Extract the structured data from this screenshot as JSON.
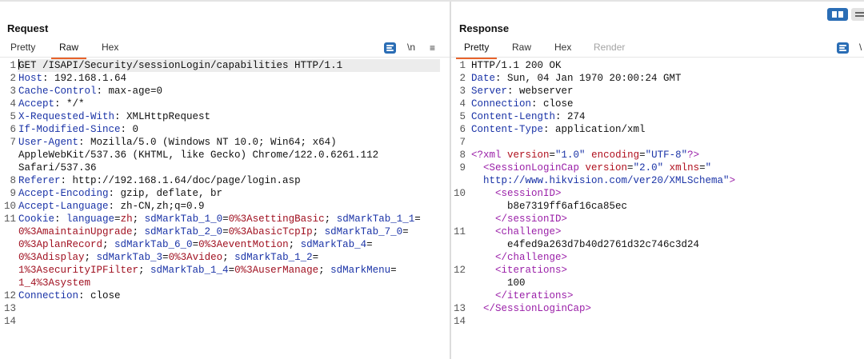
{
  "request": {
    "title": "Request",
    "tabs": [
      "Pretty",
      "Raw",
      "Hex"
    ],
    "active_tab": "Raw",
    "newline_label": "\\n",
    "menu_icon": "hamburger-menu-icon",
    "lines": [
      {
        "n": "1",
        "parts": [
          {
            "t": "GET /ISAPI/Security/sessionLogin/capabilities HTTP/1.1",
            "c": "plain"
          }
        ]
      },
      {
        "n": "2",
        "parts": [
          {
            "t": "Host",
            "c": "key"
          },
          {
            "t": ": 192.168.1.64",
            "c": "plain"
          }
        ]
      },
      {
        "n": "3",
        "parts": [
          {
            "t": "Cache-Control",
            "c": "key"
          },
          {
            "t": ": max-age=0",
            "c": "plain"
          }
        ]
      },
      {
        "n": "4",
        "parts": [
          {
            "t": "Accept",
            "c": "key"
          },
          {
            "t": ": */*",
            "c": "plain"
          }
        ]
      },
      {
        "n": "5",
        "parts": [
          {
            "t": "X-Requested-With",
            "c": "key"
          },
          {
            "t": ": XMLHttpRequest",
            "c": "plain"
          }
        ]
      },
      {
        "n": "6",
        "parts": [
          {
            "t": "If-Modified-Since",
            "c": "key"
          },
          {
            "t": ": 0",
            "c": "plain"
          }
        ]
      },
      {
        "n": "7",
        "parts": [
          {
            "t": "User-Agent",
            "c": "key"
          },
          {
            "t": ": Mozilla/5.0 (Windows NT 10.0; Win64; x64)",
            "c": "plain"
          }
        ]
      },
      {
        "n": "",
        "parts": [
          {
            "t": "AppleWebKit/537.36 (KHTML, like Gecko) Chrome/122.0.6261.112",
            "c": "plain"
          }
        ]
      },
      {
        "n": "",
        "parts": [
          {
            "t": "Safari/537.36",
            "c": "plain"
          }
        ]
      },
      {
        "n": "8",
        "parts": [
          {
            "t": "Referer",
            "c": "key"
          },
          {
            "t": ": http://192.168.1.64/doc/page/login.asp",
            "c": "plain"
          }
        ]
      },
      {
        "n": "9",
        "parts": [
          {
            "t": "Accept-Encoding",
            "c": "key"
          },
          {
            "t": ": gzip, deflate, br",
            "c": "plain"
          }
        ]
      },
      {
        "n": "10",
        "parts": [
          {
            "t": "Accept-Language",
            "c": "key"
          },
          {
            "t": ": zh-CN,zh;q=0.9",
            "c": "plain"
          }
        ]
      },
      {
        "n": "11",
        "parts": [
          {
            "t": "Cookie",
            "c": "key"
          },
          {
            "t": ": ",
            "c": "plain"
          },
          {
            "t": "language",
            "c": "key"
          },
          {
            "t": "=",
            "c": "plain"
          },
          {
            "t": "zh",
            "c": "val"
          },
          {
            "t": "; ",
            "c": "plain"
          },
          {
            "t": "sdMarkTab_1_0",
            "c": "key"
          },
          {
            "t": "=",
            "c": "plain"
          },
          {
            "t": "0%3AsettingBasic",
            "c": "val"
          },
          {
            "t": "; ",
            "c": "plain"
          },
          {
            "t": "sdMarkTab_1_1",
            "c": "key"
          },
          {
            "t": "=",
            "c": "plain"
          }
        ]
      },
      {
        "n": "",
        "parts": [
          {
            "t": "0%3AmaintainUpgrade",
            "c": "val"
          },
          {
            "t": "; ",
            "c": "plain"
          },
          {
            "t": "sdMarkTab_2_0",
            "c": "key"
          },
          {
            "t": "=",
            "c": "plain"
          },
          {
            "t": "0%3AbasicTcpIp",
            "c": "val"
          },
          {
            "t": "; ",
            "c": "plain"
          },
          {
            "t": "sdMarkTab_7_0",
            "c": "key"
          },
          {
            "t": "=",
            "c": "plain"
          }
        ]
      },
      {
        "n": "",
        "parts": [
          {
            "t": "0%3AplanRecord",
            "c": "val"
          },
          {
            "t": "; ",
            "c": "plain"
          },
          {
            "t": "sdMarkTab_6_0",
            "c": "key"
          },
          {
            "t": "=",
            "c": "plain"
          },
          {
            "t": "0%3AeventMotion",
            "c": "val"
          },
          {
            "t": "; ",
            "c": "plain"
          },
          {
            "t": "sdMarkTab_4",
            "c": "key"
          },
          {
            "t": "=",
            "c": "plain"
          }
        ]
      },
      {
        "n": "",
        "parts": [
          {
            "t": "0%3Adisplay",
            "c": "val"
          },
          {
            "t": "; ",
            "c": "plain"
          },
          {
            "t": "sdMarkTab_3",
            "c": "key"
          },
          {
            "t": "=",
            "c": "plain"
          },
          {
            "t": "0%3Avideo",
            "c": "val"
          },
          {
            "t": "; ",
            "c": "plain"
          },
          {
            "t": "sdMarkTab_1_2",
            "c": "key"
          },
          {
            "t": "=",
            "c": "plain"
          }
        ]
      },
      {
        "n": "",
        "parts": [
          {
            "t": "1%3AsecurityIPFilter",
            "c": "val"
          },
          {
            "t": "; ",
            "c": "plain"
          },
          {
            "t": "sdMarkTab_1_4",
            "c": "key"
          },
          {
            "t": "=",
            "c": "plain"
          },
          {
            "t": "0%3AuserManage",
            "c": "val"
          },
          {
            "t": "; ",
            "c": "plain"
          },
          {
            "t": "sdMarkMenu",
            "c": "key"
          },
          {
            "t": "=",
            "c": "plain"
          }
        ]
      },
      {
        "n": "",
        "parts": [
          {
            "t": "1_4%3Asystem",
            "c": "val"
          }
        ]
      },
      {
        "n": "12",
        "parts": [
          {
            "t": "Connection",
            "c": "key"
          },
          {
            "t": ": close",
            "c": "plain"
          }
        ]
      },
      {
        "n": "13",
        "parts": []
      },
      {
        "n": "14",
        "parts": []
      }
    ]
  },
  "response": {
    "title": "Response",
    "tabs": [
      "Pretty",
      "Raw",
      "Hex",
      "Render"
    ],
    "active_tab": "Pretty",
    "newline_label": "\\",
    "lines": [
      {
        "n": "1",
        "parts": [
          {
            "t": "HTTP/1.1 200 OK",
            "c": "plain"
          }
        ]
      },
      {
        "n": "2",
        "parts": [
          {
            "t": "Date",
            "c": "key"
          },
          {
            "t": ": Sun, 04 Jan 1970 20:00:24 GMT",
            "c": "plain"
          }
        ]
      },
      {
        "n": "3",
        "parts": [
          {
            "t": "Server",
            "c": "key"
          },
          {
            "t": ": webserver",
            "c": "plain"
          }
        ]
      },
      {
        "n": "4",
        "parts": [
          {
            "t": "Connection",
            "c": "key"
          },
          {
            "t": ": close",
            "c": "plain"
          }
        ]
      },
      {
        "n": "5",
        "parts": [
          {
            "t": "Content-Length",
            "c": "key"
          },
          {
            "t": ": 274",
            "c": "plain"
          }
        ]
      },
      {
        "n": "6",
        "parts": [
          {
            "t": "Content-Type",
            "c": "key"
          },
          {
            "t": ": application/xml",
            "c": "plain"
          }
        ]
      },
      {
        "n": "7",
        "parts": []
      },
      {
        "n": "8",
        "parts": [
          {
            "t": "<?xml ",
            "c": "tag"
          },
          {
            "t": "version",
            "c": "attr"
          },
          {
            "t": "=",
            "c": "plain"
          },
          {
            "t": "\"1.0\"",
            "c": "str"
          },
          {
            "t": " ",
            "c": "plain"
          },
          {
            "t": "encoding",
            "c": "attr"
          },
          {
            "t": "=",
            "c": "plain"
          },
          {
            "t": "\"UTF-8\"",
            "c": "str"
          },
          {
            "t": "?>",
            "c": "tag"
          }
        ]
      },
      {
        "n": "9",
        "parts": [
          {
            "t": "  <SessionLoginCap ",
            "c": "tag"
          },
          {
            "t": "version",
            "c": "attr"
          },
          {
            "t": "=",
            "c": "plain"
          },
          {
            "t": "\"2.0\"",
            "c": "str"
          },
          {
            "t": " ",
            "c": "plain"
          },
          {
            "t": "xmlns",
            "c": "attr"
          },
          {
            "t": "=",
            "c": "plain"
          },
          {
            "t": "\"",
            "c": "str"
          }
        ]
      },
      {
        "n": "",
        "parts": [
          {
            "t": "  http://www.hikvision.com/ver20/XMLSchema\"",
            "c": "str"
          },
          {
            "t": ">",
            "c": "tag"
          }
        ]
      },
      {
        "n": "10",
        "parts": [
          {
            "t": "    <sessionID>",
            "c": "tag"
          }
        ]
      },
      {
        "n": "",
        "parts": [
          {
            "t": "      b8e7319ff6af16ca85ec",
            "c": "plain"
          }
        ]
      },
      {
        "n": "",
        "parts": [
          {
            "t": "    </sessionID>",
            "c": "tag"
          }
        ]
      },
      {
        "n": "11",
        "parts": [
          {
            "t": "    <challenge>",
            "c": "tag"
          }
        ]
      },
      {
        "n": "",
        "parts": [
          {
            "t": "      e4fed9a263d7b40d2761d32c746c3d24",
            "c": "plain"
          }
        ]
      },
      {
        "n": "",
        "parts": [
          {
            "t": "    </challenge>",
            "c": "tag"
          }
        ]
      },
      {
        "n": "12",
        "parts": [
          {
            "t": "    <iterations>",
            "c": "tag"
          }
        ]
      },
      {
        "n": "",
        "parts": [
          {
            "t": "      100",
            "c": "plain"
          }
        ]
      },
      {
        "n": "",
        "parts": [
          {
            "t": "    </iterations>",
            "c": "tag"
          }
        ]
      },
      {
        "n": "13",
        "parts": [
          {
            "t": "  </SessionLoginCap>",
            "c": "tag"
          }
        ]
      },
      {
        "n": "14",
        "parts": []
      }
    ]
  },
  "colors": {
    "accent_tab_underline": "#e8632b",
    "header_name": "#1a33a7",
    "cookie_value": "#a01020",
    "xml_tag": "#9a1fa8",
    "icon_button": "#2a6db5"
  }
}
